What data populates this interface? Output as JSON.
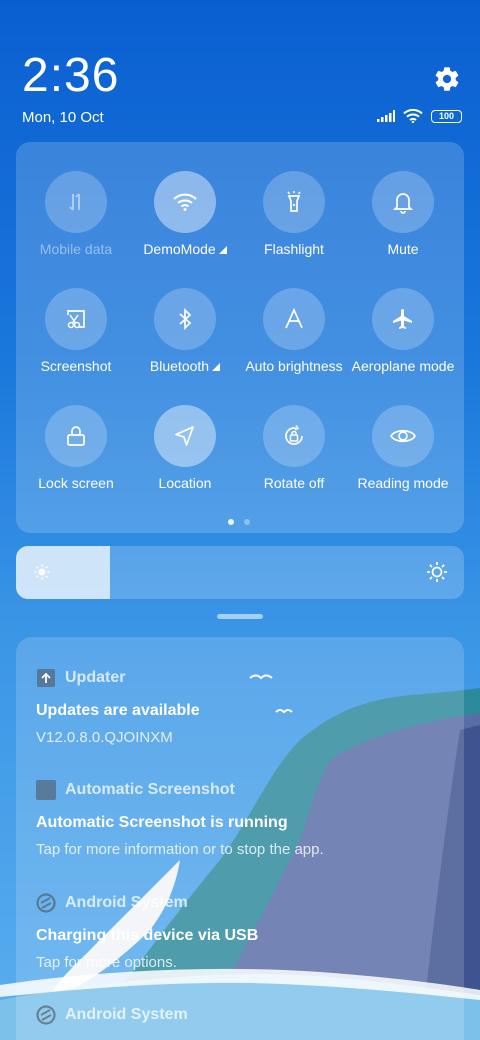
{
  "clock": {
    "time": "2:36",
    "date": "Mon, 10 Oct"
  },
  "status_bar": {
    "battery": "100"
  },
  "quick_settings": {
    "tiles": [
      {
        "label": "Mobile data",
        "icon": "mobile-data-icon",
        "state": "disabled"
      },
      {
        "label": "DemoMode",
        "icon": "wifi-icon",
        "state": "on",
        "has_more": true
      },
      {
        "label": "Flashlight",
        "icon": "flashlight-icon",
        "state": "off"
      },
      {
        "label": "Mute",
        "icon": "bell-icon",
        "state": "off"
      },
      {
        "label": "Screenshot",
        "icon": "screenshot-icon",
        "state": "off"
      },
      {
        "label": "Bluetooth",
        "icon": "bluetooth-icon",
        "state": "off",
        "has_more": true
      },
      {
        "label": "Auto brightness",
        "icon": "auto-brightness-icon",
        "state": "off"
      },
      {
        "label": "Aeroplane mode",
        "icon": "airplane-icon",
        "state": "off"
      },
      {
        "label": "Lock screen",
        "icon": "lock-icon",
        "state": "off"
      },
      {
        "label": "Location",
        "icon": "location-icon",
        "state": "on"
      },
      {
        "label": "Rotate off",
        "icon": "rotate-lock-icon",
        "state": "off"
      },
      {
        "label": "Reading mode",
        "icon": "eye-icon",
        "state": "off"
      }
    ],
    "page_index": 1,
    "page_count": 2
  },
  "brightness": {
    "level": 0.21
  },
  "notifications": [
    {
      "app": "Updater",
      "icon": "updater-icon",
      "title": "Updates are available",
      "body": "V12.0.8.0.QJOINXM"
    },
    {
      "app": "Automatic Screenshot",
      "icon": "screenshot-app-icon",
      "title": "Automatic Screenshot is running",
      "body": "Tap for more information or to stop the app."
    },
    {
      "app": "Android System",
      "icon": "android-system-icon",
      "title": "Charging this device via USB",
      "body": "Tap for more options."
    },
    {
      "app": "Android System",
      "icon": "android-system-icon",
      "title": "",
      "body": ""
    }
  ],
  "colors": {
    "background_top": "#0a5fd0",
    "background_bottom": "#5aaeee"
  }
}
